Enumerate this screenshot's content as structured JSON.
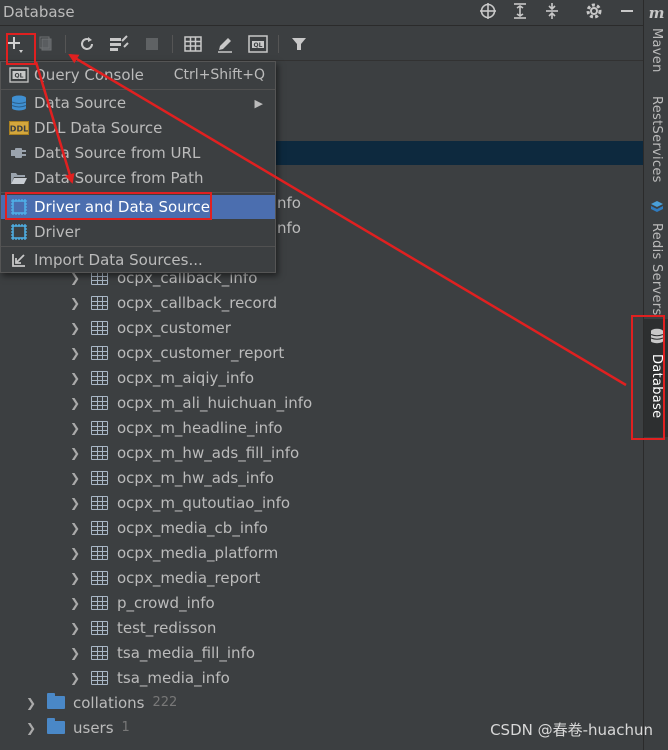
{
  "window": {
    "title": "Database"
  },
  "sidebar": {
    "tabs": [
      {
        "label": "Maven",
        "icon": "maven-icon"
      },
      {
        "label": "RestServices",
        "icon": ""
      },
      {
        "label": "Redis Servers",
        "icon": "redis-icon"
      },
      {
        "label": "Database",
        "icon": "database-icon"
      }
    ]
  },
  "menu": {
    "items": [
      {
        "label": "Query Console",
        "shortcut": "Ctrl+Shift+Q",
        "icon": "ql-icon"
      },
      {
        "label": "Data Source",
        "icon": "datasource-icon",
        "submenu": true
      },
      {
        "label": "DDL Data Source",
        "icon": "ddl-icon"
      },
      {
        "label": "Data Source from URL",
        "icon": "plug-icon"
      },
      {
        "label": "Data Source from Path",
        "icon": "folder-open-icon"
      },
      {
        "label": "Driver and Data Source",
        "icon": "driver-icon",
        "active": true
      },
      {
        "label": "Driver",
        "icon": "driver-icon"
      },
      {
        "label": "Import Data Sources...",
        "icon": "import-icon"
      }
    ]
  },
  "tree": {
    "partial_rows": [
      "nfo",
      "nfo"
    ],
    "tables": [
      "ocpx_callback_info",
      "ocpx_callback_record",
      "ocpx_customer",
      "ocpx_customer_report",
      "ocpx_m_aiqiy_info",
      "ocpx_m_ali_huichuan_info",
      "ocpx_m_headline_info",
      "ocpx_m_hw_ads_fill_info",
      "ocpx_m_hw_ads_info",
      "ocpx_m_qutoutiao_info",
      "ocpx_media_cb_info",
      "ocpx_media_platform",
      "ocpx_media_report",
      "p_crowd_info",
      "test_redisson",
      "tsa_media_fill_info",
      "tsa_media_info"
    ],
    "folders": [
      {
        "label": "collations",
        "count": "222"
      },
      {
        "label": "users",
        "count": "1"
      }
    ]
  },
  "watermark": "CSDN @春卷-huachun",
  "colors": {
    "accent": "#4b6eaf",
    "annotation": "#e02020",
    "selection": "#0d293e"
  }
}
